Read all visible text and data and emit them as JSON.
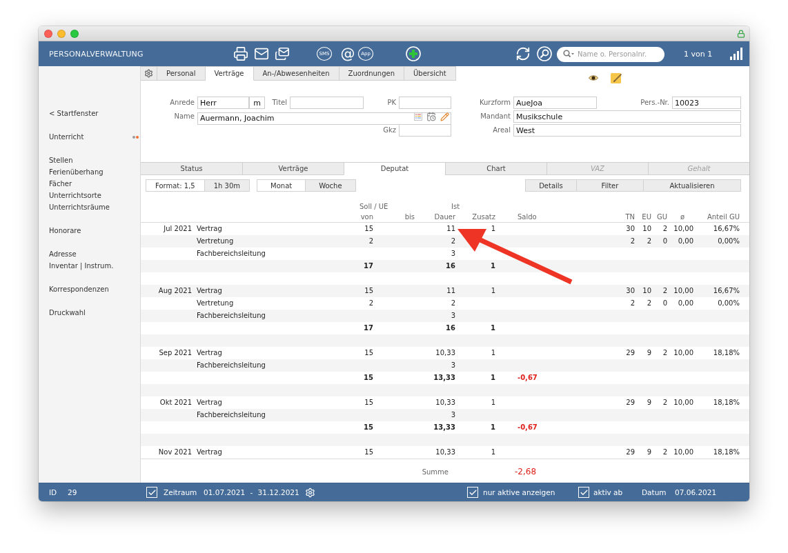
{
  "header": {
    "app_title": "PERSONALVERWALTUNG",
    "message_buttons": [
      {
        "kind": "bubble",
        "label": "SMS"
      },
      {
        "kind": "glyph",
        "label": "@"
      },
      {
        "kind": "bubble",
        "label": "App"
      }
    ],
    "search": {
      "placeholder": "Name o. Personalnr."
    },
    "record_counter": "1 von 1"
  },
  "sidebar": {
    "groups": [
      {
        "items": [
          {
            "label": "< Startfenster"
          }
        ]
      },
      {
        "items": [
          {
            "label": "Unterricht",
            "dots": [
              {
                "color": "#9b9b9b"
              },
              {
                "color": "#f36f2c"
              }
            ]
          }
        ]
      },
      {
        "items": [
          {
            "label": "Stellen"
          },
          {
            "label": "Ferienüberhang"
          },
          {
            "label": "Fächer"
          },
          {
            "label": "Unterrichtsorte"
          },
          {
            "label": "Unterrichtsräume"
          }
        ]
      },
      {
        "items": [
          {
            "label": "Honorare"
          }
        ]
      },
      {
        "items": [
          {
            "label": "Adresse"
          },
          {
            "label": "Inventar | Instrum."
          }
        ]
      },
      {
        "items": [
          {
            "label": "Korrespondenzen"
          }
        ]
      },
      {
        "items": [
          {
            "label": "Druckwahl"
          }
        ]
      }
    ]
  },
  "tabs": [
    {
      "label": "Personal",
      "selected": false
    },
    {
      "label": "Verträge",
      "selected": true
    },
    {
      "label": "An-/Abwesenheiten",
      "selected": false
    },
    {
      "label": "Zuordnungen",
      "selected": false
    },
    {
      "label": "Übersicht",
      "selected": false
    }
  ],
  "form": {
    "anrede": {
      "label": "Anrede",
      "value": "Herr"
    },
    "anrede_code": {
      "value": "m"
    },
    "titel": {
      "label": "Titel"
    },
    "pk": {
      "label": "PK"
    },
    "name": {
      "label": "Name",
      "value": "Auermann, Joachim"
    },
    "gkz": {
      "label": "Gkz"
    },
    "kurzform": {
      "label": "Kurzform",
      "value": "AueJoa"
    },
    "pers_nr": {
      "label": "Pers.-Nr.",
      "value": "10023"
    },
    "mandant": {
      "label": "Mandant",
      "value": "Musikschule"
    },
    "areal": {
      "label": "Areal",
      "value": "West"
    }
  },
  "subtabs": [
    {
      "label": "Status",
      "selected": false,
      "disabled": false
    },
    {
      "label": "Verträge",
      "selected": false,
      "disabled": false
    },
    {
      "label": "Deputat",
      "selected": true,
      "disabled": false
    },
    {
      "label": "Chart",
      "selected": false,
      "disabled": false
    },
    {
      "label": "VAZ",
      "selected": false,
      "disabled": true
    },
    {
      "label": "Gehalt",
      "selected": false,
      "disabled": true
    }
  ],
  "format_options": [
    {
      "label": "Format: 1,5",
      "selected": true
    },
    {
      "label": "1h 30m",
      "selected": false
    }
  ],
  "period_options": [
    {
      "label": "Monat",
      "selected": true
    },
    {
      "label": "Woche",
      "selected": false
    }
  ],
  "actions": [
    {
      "label": "Details"
    },
    {
      "label": "Filter"
    },
    {
      "label": "Aktualisieren"
    }
  ],
  "table": {
    "column_groups": [
      "Soll / UE",
      "Ist"
    ],
    "columns": [
      "von",
      "bis",
      "Dauer",
      "Zusatz",
      "Saldo",
      "TN",
      "EU",
      "GU",
      "ø",
      "Anteil GU"
    ],
    "rows": [
      {
        "kind": "entry",
        "month": "Jul 2021",
        "type": "Vertrag",
        "von": "15",
        "dauer": "11",
        "zusatz": "1",
        "tn": "30",
        "eu": "10",
        "gu": "2",
        "avg": "10,00",
        "anteil_gu": "16,67%"
      },
      {
        "kind": "entry",
        "type": "Vertretung",
        "von": "2",
        "dauer": "2",
        "tn": "2",
        "eu": "2",
        "gu": "0",
        "avg": "0,00",
        "anteil_gu": "0,00%"
      },
      {
        "kind": "entry",
        "type": "Fachbereichsleitung",
        "dauer": "3"
      },
      {
        "kind": "total",
        "von": "17",
        "dauer": "16",
        "zusatz": "1"
      },
      {
        "kind": "spacer"
      },
      {
        "kind": "entry",
        "month": "Aug 2021",
        "type": "Vertrag",
        "von": "15",
        "dauer": "11",
        "zusatz": "1",
        "tn": "30",
        "eu": "10",
        "gu": "2",
        "avg": "10,00",
        "anteil_gu": "16,67%"
      },
      {
        "kind": "entry",
        "type": "Vertretung",
        "von": "2",
        "dauer": "2",
        "tn": "2",
        "eu": "2",
        "gu": "0",
        "avg": "0,00",
        "anteil_gu": "0,00%"
      },
      {
        "kind": "entry",
        "type": "Fachbereichsleitung",
        "dauer": "3"
      },
      {
        "kind": "total",
        "von": "17",
        "dauer": "16",
        "zusatz": "1"
      },
      {
        "kind": "spacer"
      },
      {
        "kind": "entry",
        "month": "Sep 2021",
        "type": "Vertrag",
        "von": "15",
        "dauer": "10,33",
        "zusatz": "1",
        "tn": "29",
        "eu": "9",
        "gu": "2",
        "avg": "10,00",
        "anteil_gu": "18,18%"
      },
      {
        "kind": "entry",
        "type": "Fachbereichsleitung",
        "dauer": "3"
      },
      {
        "kind": "total",
        "von": "15",
        "dauer": "13,33",
        "zusatz": "1",
        "saldo": "-0,67"
      },
      {
        "kind": "spacer"
      },
      {
        "kind": "entry",
        "month": "Okt 2021",
        "type": "Vertrag",
        "von": "15",
        "dauer": "10,33",
        "zusatz": "1",
        "tn": "29",
        "eu": "9",
        "gu": "2",
        "avg": "10,00",
        "anteil_gu": "18,18%"
      },
      {
        "kind": "entry",
        "type": "Fachbereichsleitung",
        "dauer": "3"
      },
      {
        "kind": "total",
        "von": "15",
        "dauer": "13,33",
        "zusatz": "1",
        "saldo": "-0,67"
      },
      {
        "kind": "spacer"
      },
      {
        "kind": "entry",
        "month": "Nov 2021",
        "type": "Vertrag",
        "von": "15",
        "dauer": "10,33",
        "zusatz": "1",
        "tn": "29",
        "eu": "9",
        "gu": "2",
        "avg": "10,00",
        "anteil_gu": "18,18%"
      }
    ],
    "summary": {
      "label": "Summe",
      "saldo": "-2,68"
    }
  },
  "status_bar": {
    "id_label": "ID",
    "id_value": "29",
    "period": {
      "label": "Zeitraum",
      "checked": true,
      "range": "01.07.2021 - 31.12.2021"
    },
    "active_only": {
      "label": "nur aktive anzeigen",
      "checked": true
    },
    "active_from": {
      "label": "aktiv ab",
      "checked": true
    },
    "date_label": "Datum",
    "date_value": "07.06.2021"
  }
}
